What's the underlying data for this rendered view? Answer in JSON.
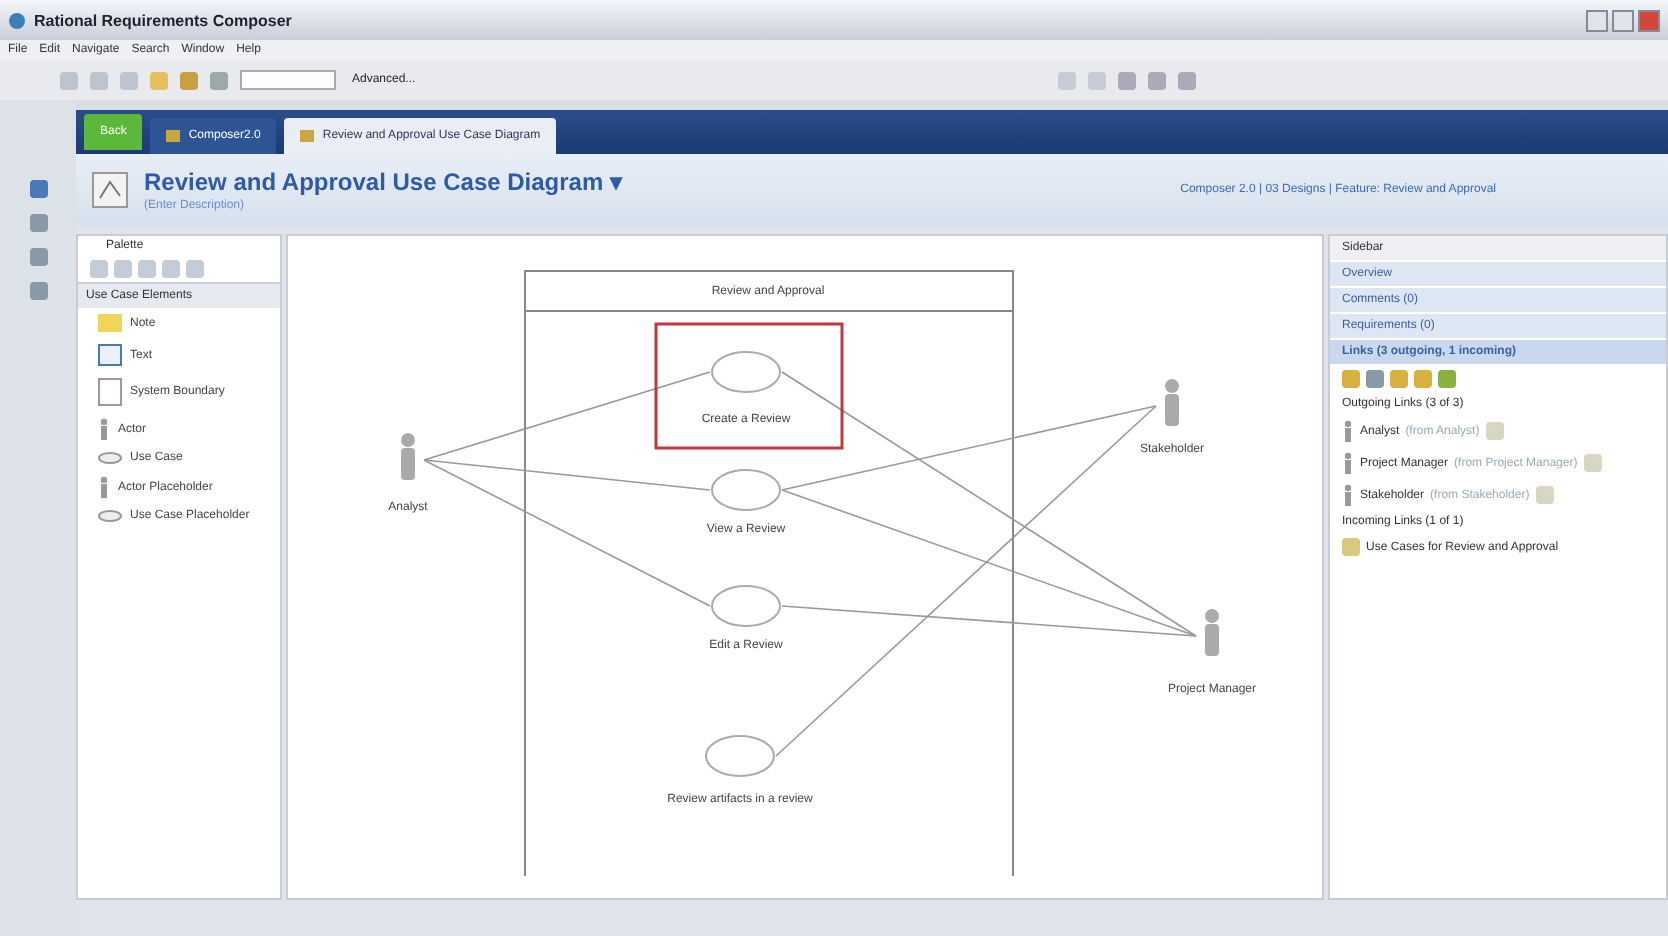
{
  "window": {
    "title": "Rational Requirements Composer"
  },
  "menu": [
    "File",
    "Edit",
    "Navigate",
    "Search",
    "Window",
    "Help"
  ],
  "toolbar": {
    "search_button": "Advanced..."
  },
  "editor_tabs": [
    {
      "label": "Back",
      "kind": "button",
      "selected": false
    },
    {
      "label": "Composer2.0",
      "kind": "project",
      "selected": false
    },
    {
      "label": "Review and Approval Use Case Diagram",
      "kind": "editor",
      "selected": true
    }
  ],
  "header": {
    "title": "Review and Approval Use Case Diagram",
    "description": "(Enter Description)",
    "menu_glyph": "▾",
    "breadcrumb": "Composer 2.0 | 03 Designs | Feature: Review and Approval"
  },
  "palette": {
    "title": "Palette",
    "section": "Use Case Elements",
    "items": [
      {
        "label": "Note",
        "kind": "note"
      },
      {
        "label": "Text",
        "kind": "text"
      },
      {
        "label": "System Boundary",
        "kind": "boundary"
      },
      {
        "label": "Actor",
        "kind": "actor"
      },
      {
        "label": "Use Case",
        "kind": "usecase"
      },
      {
        "label": "Actor Placeholder",
        "kind": "actor"
      },
      {
        "label": "Use Case Placeholder",
        "kind": "usecase"
      }
    ]
  },
  "diagram": {
    "boundary": "Review and Approval",
    "use_cases": [
      {
        "label": "Create a Review",
        "selected": true
      },
      {
        "label": "View a Review",
        "selected": false
      },
      {
        "label": "Edit a Review",
        "selected": false
      },
      {
        "label": "Review artifacts in a review",
        "selected": false
      }
    ],
    "actors": [
      {
        "label": "Analyst"
      },
      {
        "label": "Stakeholder"
      },
      {
        "label": "Project Manager"
      }
    ]
  },
  "sidebar": {
    "title": "Sidebar",
    "sections": [
      {
        "label": "Overview",
        "expanded": false
      },
      {
        "label": "Comments (0)",
        "expanded": false
      },
      {
        "label": "Requirements (0)",
        "expanded": false
      },
      {
        "label": "Links (3 outgoing, 1 incoming)",
        "expanded": true
      }
    ],
    "outgoing_title": "Outgoing Links (3 of 3)",
    "outgoing": [
      {
        "name": "Analyst",
        "detail": "(from Analyst)"
      },
      {
        "name": "Project Manager",
        "detail": "(from Project Manager)"
      },
      {
        "name": "Stakeholder",
        "detail": "(from Stakeholder)"
      }
    ],
    "incoming_title": "Incoming Links (1 of 1)",
    "incoming": [
      {
        "name": "Use Cases for Review and Approval"
      }
    ]
  }
}
